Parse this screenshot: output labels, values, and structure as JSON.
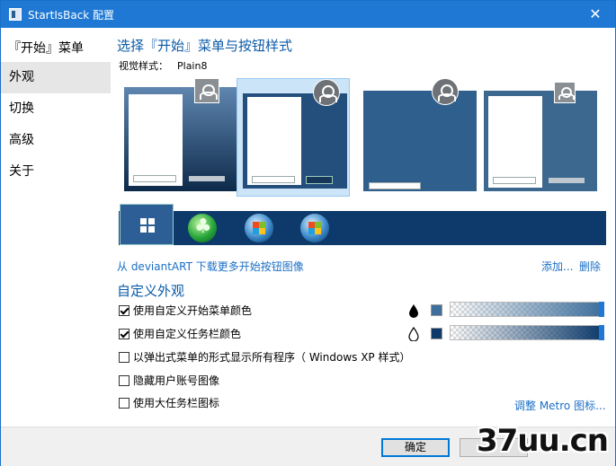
{
  "window": {
    "title": "StartIsBack 配置",
    "close_glyph": "✕"
  },
  "sidebar": {
    "header": "『开始』菜单",
    "items": [
      {
        "label": "外观",
        "selected": true
      },
      {
        "label": "切换",
        "selected": false
      },
      {
        "label": "高级",
        "selected": false
      },
      {
        "label": "关于",
        "selected": false
      }
    ]
  },
  "main": {
    "section_title": "选择『开始』菜单与按钮样式",
    "visual_style_label": "视觉样式：",
    "visual_style_value": "Plain8",
    "styles_selected_index": 1,
    "orbs_selected_index": 0,
    "download_link": "从 deviantART 下载更多开始按钮图像",
    "add_link": "添加...",
    "delete_link": "删除",
    "custom_title": "自定义外观",
    "options": [
      {
        "label": "使用自定义开始菜单颜色",
        "checked": true
      },
      {
        "label": "使用自定义任务栏颜色",
        "checked": true
      },
      {
        "label": "以弹出式菜单的形式显示所有程序（ Windows XP 样式）",
        "checked": false
      },
      {
        "label": "隐藏用户账号图像",
        "checked": false
      },
      {
        "label": "使用大任务栏图标",
        "checked": false
      }
    ],
    "start_menu_color": "#3e6f9c",
    "taskbar_color": "#0e3a6b",
    "metro_link": "调整 Metro 图标..."
  },
  "footer": {
    "ok_label": "确定",
    "cancel_label": ""
  },
  "watermark": "37uu.cn"
}
